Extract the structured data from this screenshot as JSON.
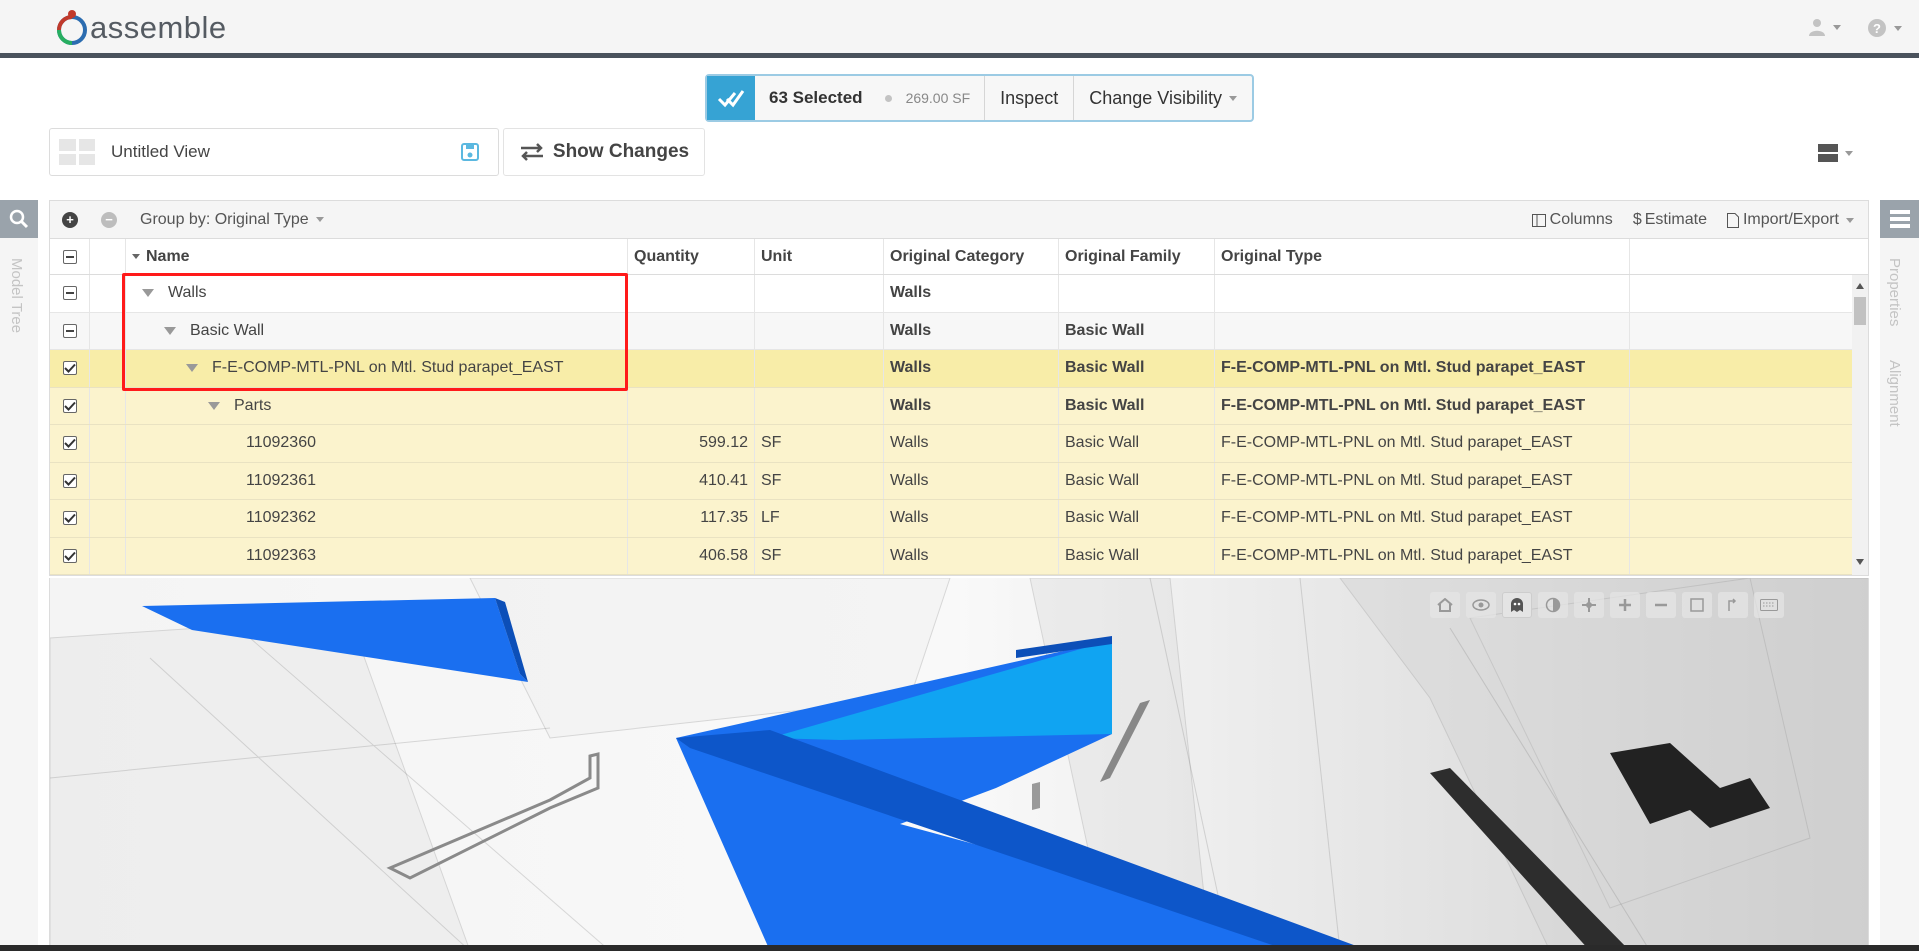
{
  "app": {
    "brand": "assemble"
  },
  "selection": {
    "count_label": "63 Selected",
    "area": "269.00 SF",
    "inspect_label": "Inspect",
    "visibility_label": "Change Visibility"
  },
  "view": {
    "name": "Untitled View",
    "show_changes_label": "Show Changes"
  },
  "side_tabs": {
    "left": "Model Tree",
    "right_1": "Properties",
    "right_2": "Alignment"
  },
  "grid_toolbar": {
    "group_by": "Group by: Original Type",
    "columns_label": "Columns",
    "estimate_label": "Estimate",
    "import_export_label": "Import/Export"
  },
  "columns": [
    "Name",
    "Quantity",
    "Unit",
    "Original Category",
    "Original Family",
    "Original Type"
  ],
  "rows": [
    {
      "check": "minus",
      "level": 0,
      "tri": true,
      "name": "Walls",
      "qty": "",
      "unit": "",
      "cat": "Walls",
      "fam": "",
      "type": "",
      "style": "plain",
      "bold": true
    },
    {
      "check": "minus",
      "level": 1,
      "tri": true,
      "name": "Basic Wall",
      "qty": "",
      "unit": "",
      "cat": "Walls",
      "fam": "Basic Wall",
      "type": "",
      "style": "grey",
      "bold": true
    },
    {
      "check": "checked",
      "level": 2,
      "tri": true,
      "name": "F-E-COMP-MTL-PNL on Mtl. Stud parapet_EAST",
      "qty": "",
      "unit": "",
      "cat": "Walls",
      "fam": "Basic Wall",
      "type": "F-E-COMP-MTL-PNL on Mtl. Stud parapet_EAST",
      "style": "yellow-sel",
      "bold": true
    },
    {
      "check": "checked",
      "level": 3,
      "tri": true,
      "name": "Parts",
      "qty": "",
      "unit": "",
      "cat": "Walls",
      "fam": "Basic Wall",
      "type": "F-E-COMP-MTL-PNL on Mtl. Stud parapet_EAST",
      "style": "yellow",
      "bold": true
    },
    {
      "check": "checked",
      "level": 4,
      "tri": false,
      "name": "11092360",
      "qty": "599.12",
      "unit": "SF",
      "cat": "Walls",
      "fam": "Basic Wall",
      "type": "F-E-COMP-MTL-PNL on Mtl. Stud parapet_EAST",
      "style": "yellow",
      "bold": false
    },
    {
      "check": "checked",
      "level": 4,
      "tri": false,
      "name": "11092361",
      "qty": "410.41",
      "unit": "SF",
      "cat": "Walls",
      "fam": "Basic Wall",
      "type": "F-E-COMP-MTL-PNL on Mtl. Stud parapet_EAST",
      "style": "yellow",
      "bold": false
    },
    {
      "check": "checked",
      "level": 4,
      "tri": false,
      "name": "11092362",
      "qty": "117.35",
      "unit": "LF",
      "cat": "Walls",
      "fam": "Basic Wall",
      "type": "F-E-COMP-MTL-PNL on Mtl. Stud parapet_EAST",
      "style": "yellow",
      "bold": false
    },
    {
      "check": "checked",
      "level": 4,
      "tri": false,
      "name": "11092363",
      "qty": "406.58",
      "unit": "SF",
      "cat": "Walls",
      "fam": "Basic Wall",
      "type": "F-E-COMP-MTL-PNL on Mtl. Stud parapet_EAST",
      "style": "yellow",
      "bold": false
    }
  ],
  "colors": {
    "accent": "#36a3d4",
    "selected_row": "#f8eda8",
    "row_yellow": "#fbf3cd",
    "highlight": "#ff1a1a",
    "wall_blue": "#1a6ff0"
  },
  "viewer_tools": [
    "home-icon",
    "orbit-icon",
    "ghost-icon",
    "contrast-icon",
    "pan-icon",
    "zoom-in-icon",
    "zoom-out-icon",
    "section-box-icon",
    "measure-icon",
    "keyboard-icon"
  ]
}
